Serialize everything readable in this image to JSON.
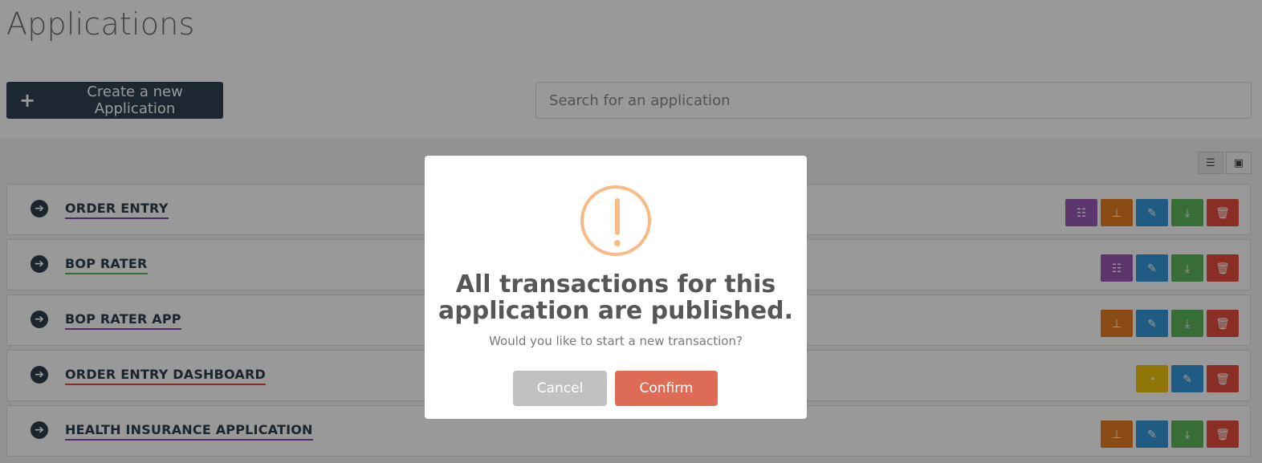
{
  "page": {
    "title": "Applications"
  },
  "toolbar": {
    "create_label": "Create a new Application",
    "create_icon": "plus-icon",
    "search_placeholder": "Search for an application"
  },
  "view_toggle": {
    "list_icon": "list-icon",
    "grid_icon": "image-icon",
    "active": "list"
  },
  "colors": {
    "database": "#9b59b6",
    "hierarchy": "#e67e22",
    "edit": "#3498db",
    "download": "#5cb85c",
    "delete": "#e74c3c",
    "dashboard": "#f1c40f",
    "underline_purple": "#8e44ad",
    "underline_green": "#5cb85c",
    "underline_red": "#e74c3c"
  },
  "applications": [
    {
      "name": "ORDER ENTRY",
      "underline": "#8e44ad",
      "actions": [
        "database",
        "hierarchy",
        "edit",
        "download",
        "delete"
      ]
    },
    {
      "name": "BOP RATER",
      "underline": "#5cb85c",
      "actions": [
        "database",
        "edit",
        "download",
        "delete"
      ]
    },
    {
      "name": "BOP RATER APP",
      "underline": "#8e44ad",
      "actions": [
        "hierarchy",
        "edit",
        "download",
        "delete"
      ]
    },
    {
      "name": "ORDER ENTRY DASHBOARD",
      "underline": "#e74c3c",
      "actions": [
        "dashboard",
        "edit",
        "delete"
      ]
    },
    {
      "name": "HEALTH INSURANCE APPLICATION",
      "underline": "#8e44ad",
      "actions": [
        "hierarchy",
        "edit",
        "download",
        "delete"
      ]
    }
  ],
  "modal": {
    "icon": "warning-icon",
    "title": "All transactions for this application are published.",
    "message": "Would you like to start a new transaction?",
    "cancel_label": "Cancel",
    "confirm_label": "Confirm"
  }
}
